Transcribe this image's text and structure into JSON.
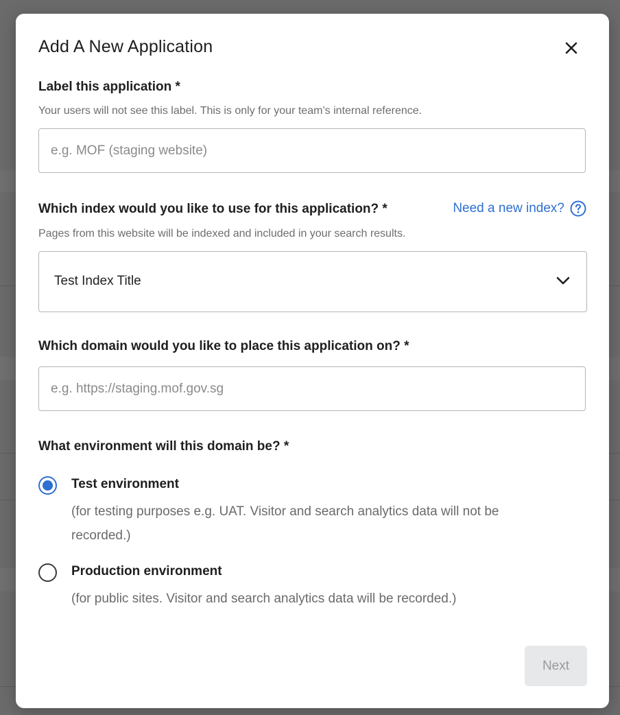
{
  "modal": {
    "title": "Add A New Application",
    "close_icon": "close-icon"
  },
  "label_field": {
    "label": "Label this application *",
    "help": "Your users will not see this label. This is only for your team’s internal reference.",
    "placeholder": "e.g. MOF (staging website)",
    "value": ""
  },
  "index_field": {
    "label": "Which index would you like to use for this application? *",
    "link_text": "Need a new index?",
    "link_icon": "help-circle-icon",
    "help": "Pages from this website will be indexed and included in your search results.",
    "selected": "Test Index Title",
    "chevron_icon": "chevron-down-icon"
  },
  "domain_field": {
    "label": "Which domain would you like to place this application on? *",
    "placeholder": "e.g. https://staging.mof.gov.sg",
    "value": ""
  },
  "environment_field": {
    "label": "What environment will this domain be? *",
    "options": [
      {
        "title": "Test environment",
        "description": "(for testing purposes e.g. UAT. Visitor and search analytics data will not be recorded.)",
        "checked": true
      },
      {
        "title": "Production environment",
        "description": "(for public sites. Visitor and search analytics data will be recorded.)",
        "checked": false
      }
    ]
  },
  "actions": {
    "next_label": "Next",
    "next_disabled": true
  },
  "colors": {
    "accent": "#2e6fd1",
    "backdrop": "#6b6b6b",
    "disabled_button_bg": "#e6e8e9",
    "disabled_button_text": "#9a9a9a"
  }
}
